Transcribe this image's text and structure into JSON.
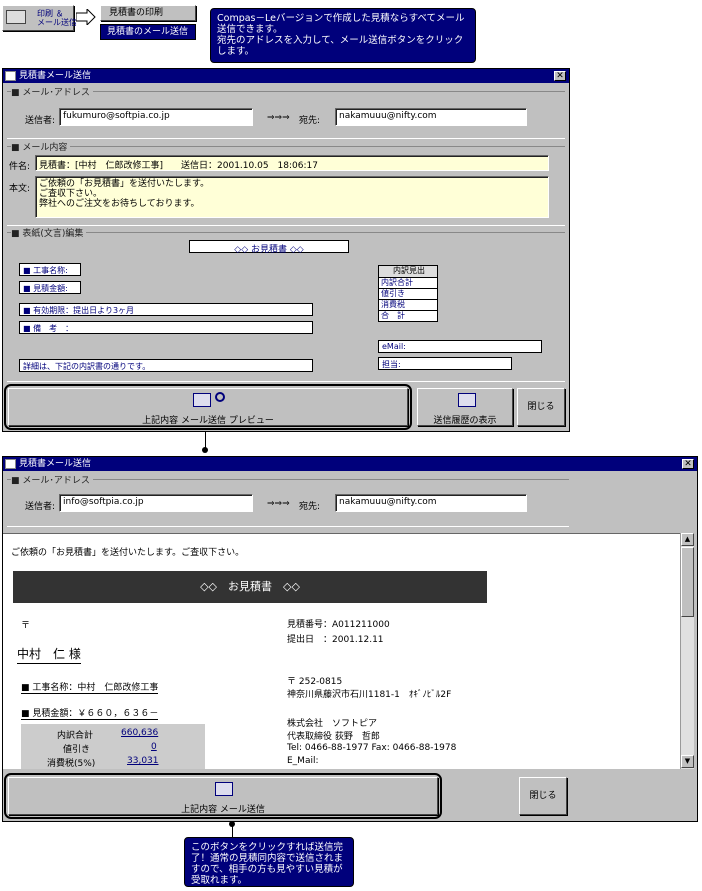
{
  "top_menu": {
    "button": "印刷 ＆\nメール送信",
    "item_print": "見積書の印刷",
    "item_mail": "見積書のメール送信"
  },
  "callout_top": "Compas－Leバージョンで作成した見積ならすべてメール送信できます。\n宛先のアドレスを入力して、メール送信ボタンをクリックします。",
  "win1": {
    "title": "見積書メール送信",
    "close": "✕",
    "addr_group": "■ メール･アドレス",
    "sender_label": "送信者:",
    "sender": "fukumuro@softpia.co.jp",
    "arrow": "⇒⇒⇒",
    "dest_label": "宛先:",
    "dest": "nakamuuu@nifty.com",
    "content_group": "■ メール内容",
    "subject_label": "件名:",
    "subject": "見積書：[中村　仁郎改修工事]　　送信日：2001.10.05　18:06:17",
    "body_label": "本文:",
    "body": "ご依頼の「お見積書」を送付いたします。\nご査収下さい。\n弊社へのご注文をお待ちしております。",
    "cover_group": "■ 表紙(文言)編集",
    "doc_title": "◇◇ お見積書 ◇◇",
    "f_work": "■ 工事名称:",
    "f_amount": "■ 見積金額:",
    "f_valid": "■ 有効期限：提出日より3ヶ月",
    "f_note": "■ 備　考　：",
    "f_detail": "詳細は、下記の内訳書の通りです。",
    "breakdown": [
      "内訳見出",
      "内訳合計",
      "値引き",
      "消費税",
      "合　計"
    ],
    "email_label": "eMail:",
    "tanto_label": "担当:",
    "preview_btn": "上記内容 メール送信 プレビュー",
    "history_btn": "送信履歴の表示",
    "close_btn": "閉じる"
  },
  "win2": {
    "title": "見積書メール送信",
    "close": "✕",
    "addr_group": "■ メール･アドレス",
    "sender_label": "送信者:",
    "sender": "info@softpia.co.jp",
    "arrow": "⇒⇒⇒",
    "dest_label": "宛先:",
    "dest": "nakamuuu@nifty.com",
    "intro": "ご依頼の「お見積書」を送付いたします。ご査収下さい。",
    "banner": "◇◇　お見積書　◇◇",
    "postal": "〒",
    "customer": "中村　仁 様",
    "est_no": "見積番号：A011211000",
    "submit": "提出日　：2001.12.11",
    "addr_postal": "〒 252-0815",
    "addr_line": "神奈川県藤沢市石川1181-1　ｵｷﾞﾉﾋﾞﾙ2F",
    "company": "株式会社　ソフトピア",
    "rep": "代表取締役 荻野　哲郎",
    "tel": "Tel: 0466-88-1977 Fax: 0466-88-1978",
    "email": "E_Mail:",
    "work": "■ 工事名称：中村　仁郎改修工事",
    "amount": "■ 見積金額：￥６６０，６３６－",
    "rows": [
      {
        "k": "内訳合計",
        "v": "660,636"
      },
      {
        "k": "値引き",
        "v": "0"
      },
      {
        "k": "消費税(5%)",
        "v": "33,031"
      }
    ],
    "send_btn": "上記内容 メール送信",
    "close_btn": "閉じる"
  },
  "callout_bottom": "このボタンをクリックすれば送信完了！通常の見積同内容で送信されますので、相手の方も見やすい見積が受取れます。"
}
